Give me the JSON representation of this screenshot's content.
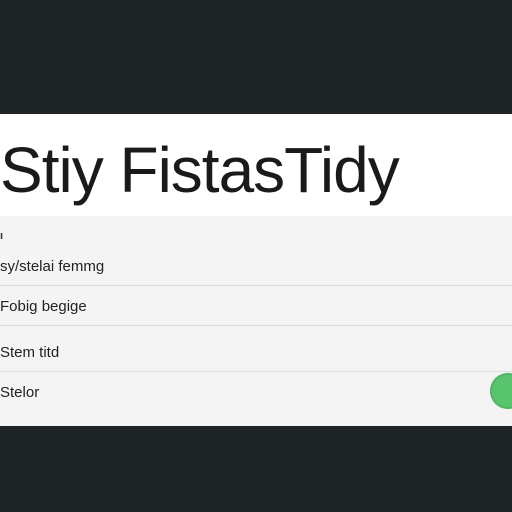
{
  "header": {
    "title": "Stiy FistasTidy"
  },
  "settings": {
    "section_label": "ı",
    "rows": [
      {
        "label": "sy/stelai femmg"
      },
      {
        "label": "Fobig begige"
      },
      {
        "label": "Stem titd"
      },
      {
        "label": "Stelor",
        "toggle": {
          "state": "on"
        }
      }
    ]
  },
  "colors": {
    "background": "#1e2326",
    "panel": "#f4f4f4",
    "toggle_on": "#58c46e"
  }
}
